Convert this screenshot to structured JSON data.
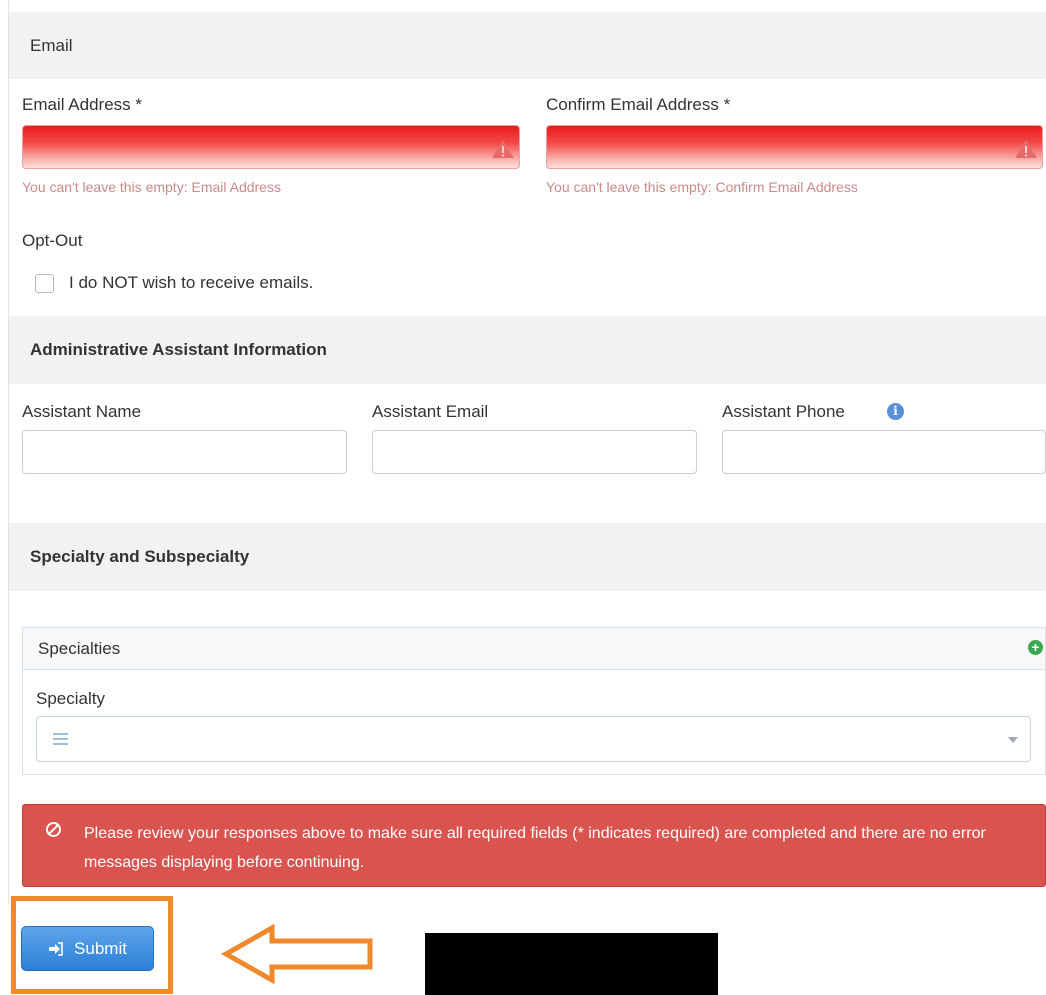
{
  "sections": {
    "email_header": "Email",
    "admin_header": "Administrative Assistant Information",
    "specialty_header": "Specialty and Subspecialty"
  },
  "email": {
    "email_label": "Email Address *",
    "confirm_label": "Confirm Email Address *",
    "email_error": "You can't leave this empty: Email Address",
    "confirm_error": "You can't leave this empty: Confirm Email Address",
    "email_value": "",
    "confirm_value": ""
  },
  "opt_out": {
    "heading": "Opt-Out",
    "checkbox_label": "I do NOT wish to receive emails.",
    "checked": false
  },
  "assistant": {
    "name_label": "Assistant Name",
    "email_label": "Assistant Email",
    "phone_label": "Assistant Phone",
    "name_value": "",
    "email_value": "",
    "phone_value": ""
  },
  "specialties": {
    "panel_title": "Specialties",
    "field_label": "Specialty",
    "selected_value": ""
  },
  "alert": {
    "message": "Please review your responses above to make sure all required fields (* indicates required) are completed and there are no error messages displaying before continuing."
  },
  "submit_label": "Submit",
  "colors": {
    "error_red": "#d9534f",
    "primary_blue": "#2c7fd6",
    "highlight_orange": "#f0882c",
    "success_green": "#3aa852"
  }
}
